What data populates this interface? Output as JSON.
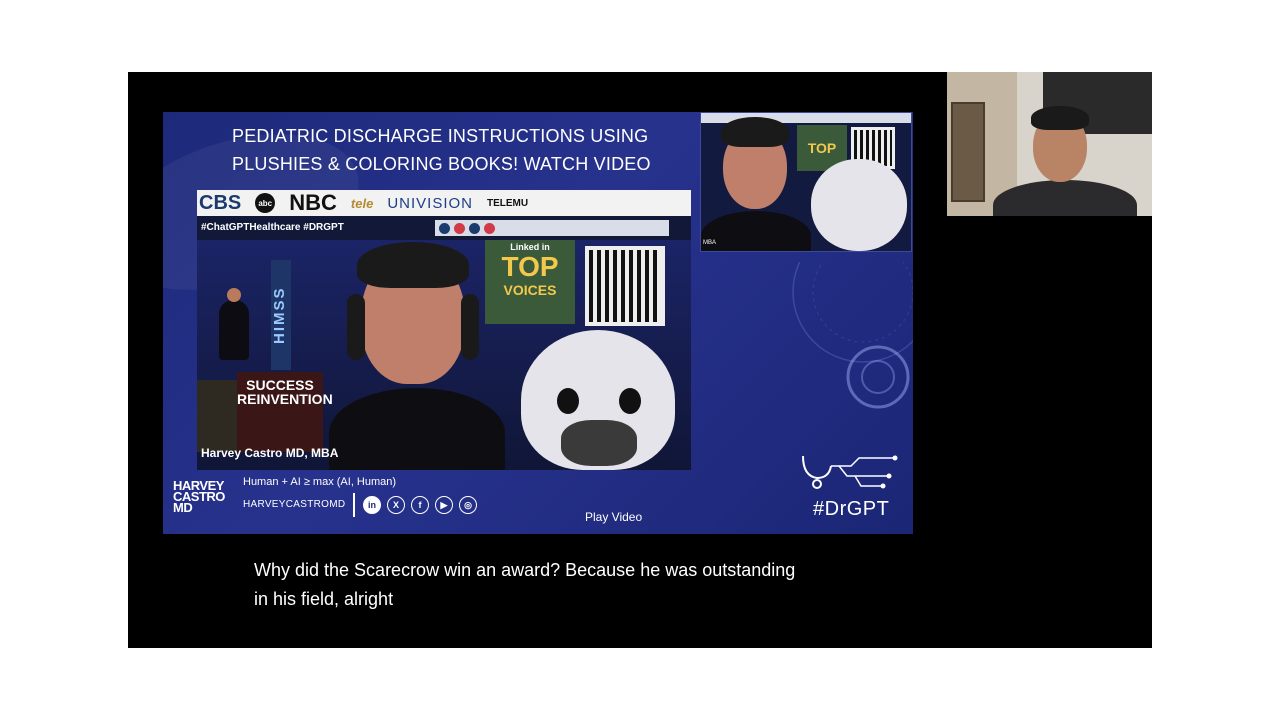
{
  "slide": {
    "title_line1": "PEDIATRIC DISCHARGE INSTRUCTIONS USING",
    "title_line2": "PLUSHIES & COLORING BOOKS! WATCH VIDEO",
    "tagline": "Human + AI ≥  max (AI, Human)",
    "handle": "HARVEYCASTROMD",
    "play_video_label": "Play Video",
    "hashtag_drgpt": "#DrGPT",
    "brand_logo": [
      "HARVEY",
      "CASTRO",
      "MD"
    ]
  },
  "cam_main": {
    "logos": [
      "CBS",
      "abc",
      "NBC",
      "tele",
      "UNIVISION",
      "TELEMU"
    ],
    "hashtag_bar": "#ChatGPTHealthcare #DRGPT",
    "himss_label": "HIMSS",
    "book_title": "SUCCESS REINVENTION",
    "top_voices_linkedin": "Linked in",
    "top_voices_line1": "TOP",
    "top_voices_line2": "VOICES",
    "name_label": "Harvey Castro MD, MBA"
  },
  "cam_small": {
    "top_voices": "TOP",
    "mba_label": "MBA"
  },
  "social_icons": [
    "in",
    "X",
    "f",
    "▶",
    "◎"
  ],
  "captions": {
    "line1": "Why did the Scarecrow win an award? Because he was outstanding",
    "line2": "in his field, alright"
  },
  "colors": {
    "slide_bg": "#27328d",
    "stage_bg": "#000000",
    "accent_red": "#e0334a"
  }
}
